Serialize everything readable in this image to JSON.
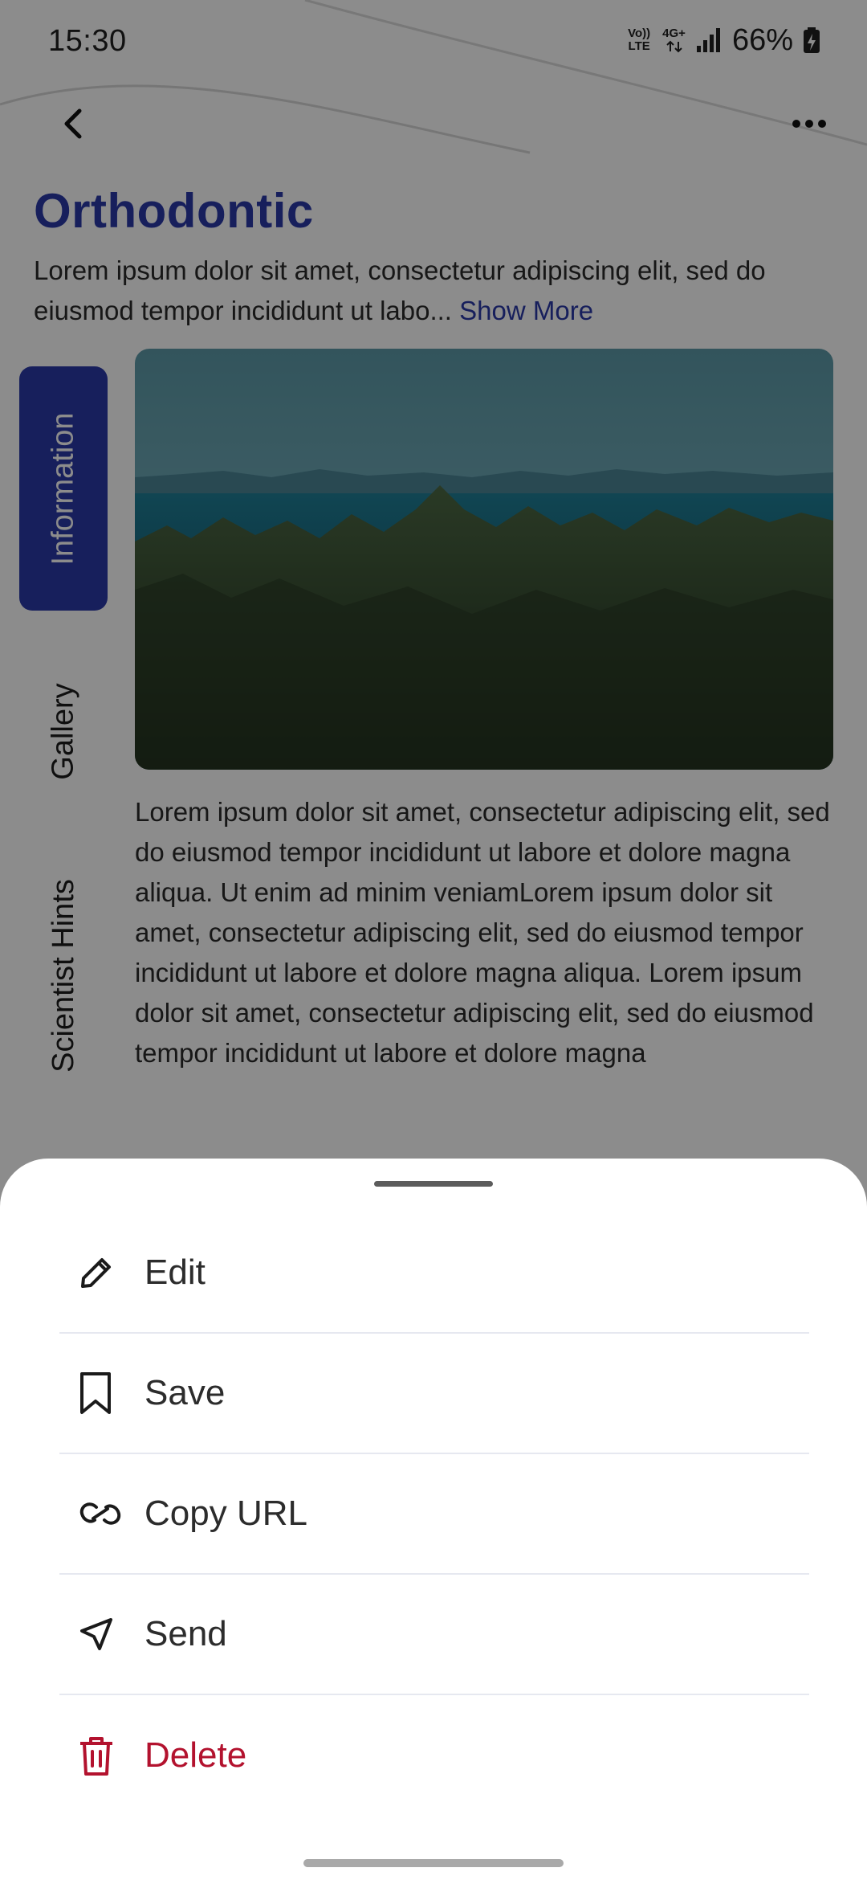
{
  "status_bar": {
    "time": "15:30",
    "network_badge_top": "Vo)) LTE",
    "network_badge_type": "4G+",
    "battery_percent": "66%"
  },
  "header": {
    "back_icon": "chevron-left-icon",
    "more_icon": "more-horizontal-icon"
  },
  "page": {
    "title": "Orthodontic",
    "intro_text": "Lorem ipsum dolor sit amet, consectetur adipiscing elit, sed do eiusmod tempor incididunt ut labo...",
    "show_more_label": "Show More",
    "tabs": [
      {
        "label": "Information",
        "active": true
      },
      {
        "label": "Gallery",
        "active": false
      },
      {
        "label": "Scientist Hints",
        "active": false
      }
    ],
    "body_text": "Lorem ipsum dolor sit amet, consectetur adipiscing elit, sed do eiusmod tempor incididunt ut labore et dolore magna aliqua. Ut enim ad minim veniamLorem ipsum dolor sit amet, consectetur adipiscing elit, sed do eiusmod tempor incididunt ut labore et dolore magna aliqua. Lorem ipsum dolor sit amet, consectetur adipiscing elit, sed do eiusmod tempor incididunt ut labore et dolore magna"
  },
  "sheet": {
    "items": [
      {
        "label": "Edit",
        "icon": "pencil-icon"
      },
      {
        "label": "Save",
        "icon": "bookmark-icon"
      },
      {
        "label": "Copy URL",
        "icon": "link-icon"
      },
      {
        "label": "Send",
        "icon": "send-icon"
      },
      {
        "label": "Delete",
        "icon": "trash-icon",
        "danger": true
      }
    ]
  },
  "colors": {
    "primary": "#2b3aa8",
    "danger": "#b3122e",
    "scrim": "rgba(0,0,0,0.45)"
  }
}
